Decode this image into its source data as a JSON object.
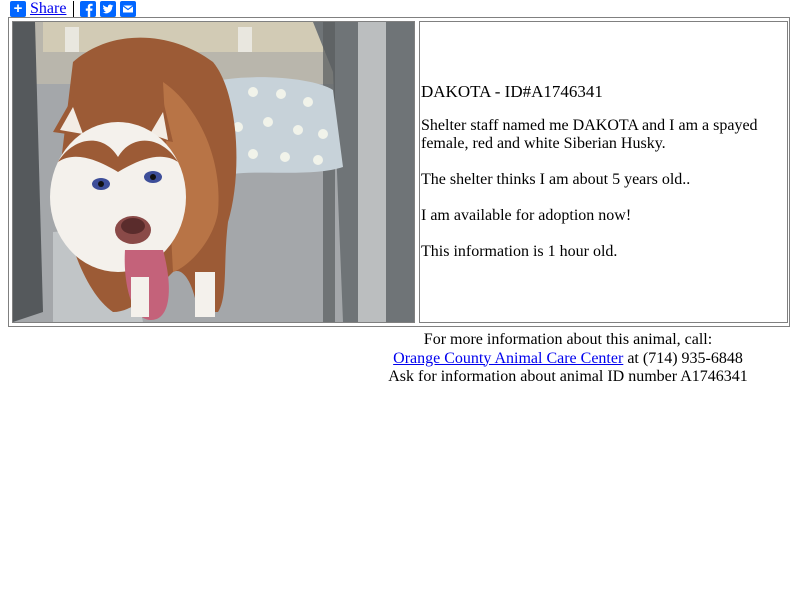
{
  "share": {
    "label": "Share",
    "icons": [
      "plus-icon",
      "facebook-icon",
      "twitter-icon",
      "email-icon"
    ],
    "accent": "#0166ff"
  },
  "animal": {
    "title_name": "DAKOTA",
    "title_sep": " - ",
    "title_id": "ID#A1746341",
    "description": "Shelter staff named me DAKOTA and I am a spayed female, red and white Siberian Husky.",
    "age": "The shelter thinks I am about 5 years old..",
    "availability": "I am available for adoption now!",
    "freshness": "This information is 1 hour old.",
    "photo": "dog-photo"
  },
  "footer": {
    "line1": "For more information about this animal, call:",
    "shelter_link": "Orange County Animal Care Center",
    "phone": " at (714) 935-6848",
    "line3": "Ask for information about animal ID number A1746341"
  }
}
